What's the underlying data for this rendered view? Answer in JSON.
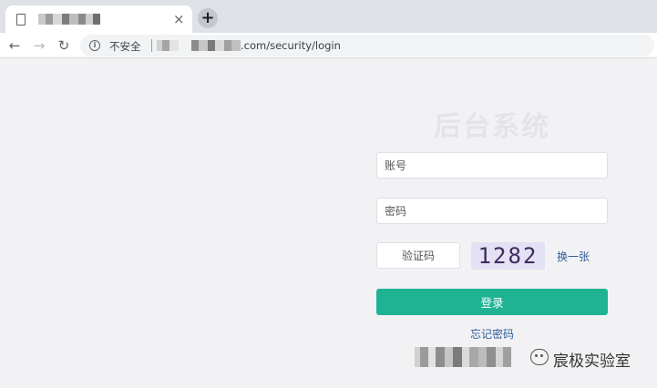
{
  "browser": {
    "tab": {
      "title": "",
      "close_glyph": "×",
      "icon": "page-icon"
    },
    "new_tab_glyph": "+",
    "nav": {
      "back_glyph": "←",
      "forward_glyph": "→",
      "reload_glyph": "↻"
    },
    "omnibox": {
      "security_icon": "info-icon",
      "security_glyph": "i",
      "security_label": "不安全",
      "url_visible": ".com/security/login"
    }
  },
  "login": {
    "title": "后台系统",
    "username_placeholder": "账号",
    "password_placeholder": "密码",
    "captcha_placeholder": "验证码",
    "captcha_code": "1282",
    "refresh_label": "换一张",
    "submit_label": "登录",
    "forgot_label": "忘记密码"
  },
  "watermark": {
    "text": "宸极实验室",
    "icon": "wechat-icon"
  },
  "colors": {
    "primary_button": "#1fb394",
    "link": "#2f5d9b",
    "page_background": "#f2f2f4",
    "captcha_background": "#e3e1f3"
  }
}
